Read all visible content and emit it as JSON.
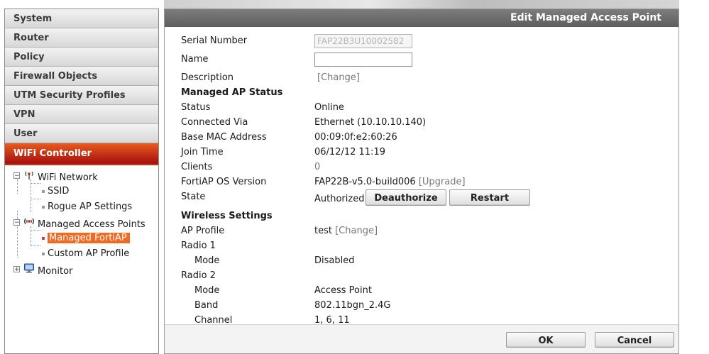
{
  "sidebar": {
    "menu": [
      {
        "label": "System"
      },
      {
        "label": "Router"
      },
      {
        "label": "Policy"
      },
      {
        "label": "Firewall Objects"
      },
      {
        "label": "UTM Security Profiles"
      },
      {
        "label": "VPN"
      },
      {
        "label": "User"
      },
      {
        "label": "WiFi Controller"
      }
    ],
    "tree": {
      "wifi_network": "WiFi Network",
      "ssid": "SSID",
      "rogue_ap": "Rogue AP Settings",
      "managed_aps": "Managed Access Points",
      "managed_fortiap": "Managed FortiAP",
      "custom_ap_profile": "Custom AP Profile",
      "monitor": "Monitor"
    }
  },
  "panel": {
    "title": "Edit Managed Access Point",
    "fields": {
      "serial_label": "Serial Number",
      "serial_value": "FAP22B3U10002582",
      "name_label": "Name",
      "name_value": "",
      "description_label": "Description",
      "description_link": "[Change]",
      "status_section": "Managed AP Status",
      "status_label": "Status",
      "status_value": "Online",
      "connected_label": "Connected Via",
      "connected_value": "Ethernet (10.10.10.140)",
      "mac_label": "Base MAC Address",
      "mac_value": "00:09:0f:e2:60:26",
      "join_label": "Join Time",
      "join_value": "06/12/12 11:19",
      "clients_label": "Clients",
      "clients_value": "0",
      "os_label": "FortiAP OS Version",
      "os_value": "FAP22B-v5.0-build006",
      "os_link_open": "[",
      "os_link": "Upgrade",
      "os_link_close": "]",
      "state_label": "State",
      "state_value": "Authorized",
      "deauthorize_button": "Deauthorize",
      "restart_button": "Restart",
      "wireless_section": "Wireless Settings",
      "ap_profile_label": "AP Profile",
      "ap_profile_value": "test",
      "ap_profile_link": "[Change]",
      "radio1_label": "Radio 1",
      "radio1_mode_label": "Mode",
      "radio1_mode_value": "Disabled",
      "radio2_label": "Radio 2",
      "radio2_mode_label": "Mode",
      "radio2_mode_value": "Access Point",
      "radio2_band_label": "Band",
      "radio2_band_value": "802.11bgn_2.4G",
      "radio2_channel_label": "Channel",
      "radio2_channel_value": "1, 6, 11"
    },
    "ok_button": "OK",
    "cancel_button": "Cancel"
  },
  "colors": {
    "active_menu": "#c4221a",
    "selected_item": "#f06a22",
    "titlebar": "#6b6b6b"
  },
  "icons": {
    "wifi_network": "wifi-antenna-icon",
    "managed_aps": "access-point-icon",
    "monitor": "monitor-icon"
  }
}
